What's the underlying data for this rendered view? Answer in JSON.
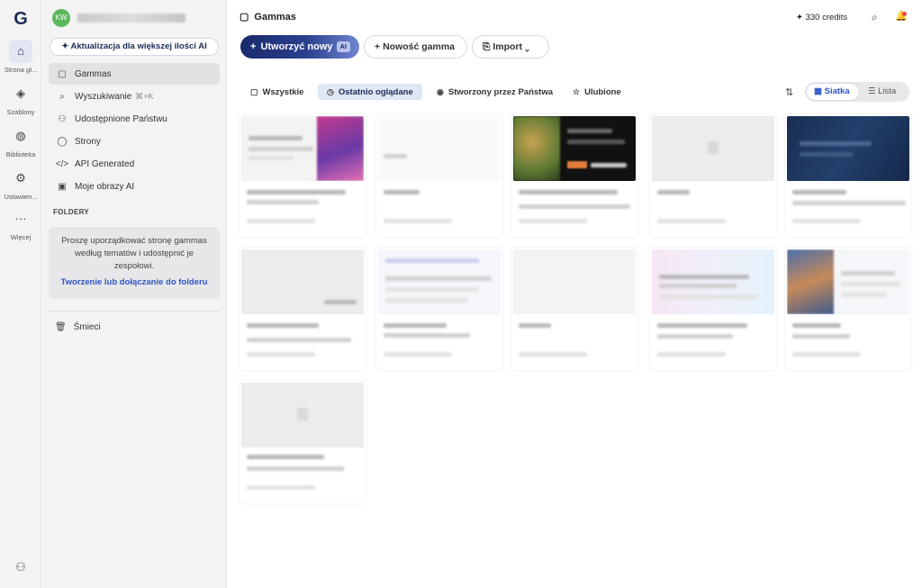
{
  "rail": {
    "logo": "G",
    "items": [
      {
        "label": "Strona gł...",
        "icon": "home-icon",
        "glyph": "⌂",
        "active": true
      },
      {
        "label": "Szablony",
        "icon": "layers-icon",
        "glyph": "◈",
        "active": false
      },
      {
        "label": "Biblioteka",
        "icon": "palette-icon",
        "glyph": "◍",
        "active": false
      },
      {
        "label": "Ustawien...",
        "icon": "gear-icon",
        "glyph": "⚙",
        "active": false
      },
      {
        "label": "Więcej",
        "icon": "more-icon",
        "glyph": "···",
        "active": false
      }
    ],
    "bottom_icon": "add-user-icon",
    "bottom_glyph": "⚇"
  },
  "sidebar": {
    "avatar_initials": "KW",
    "upgrade_label": "Aktualizacja dla większej ilości AI",
    "nav": [
      {
        "label": "Gammas",
        "icon": "file-icon",
        "glyph": "▢",
        "active": true
      },
      {
        "label": "Wyszukiwanie",
        "shortcut": "⌘+K",
        "icon": "search-icon",
        "glyph": "⌕",
        "active": false
      },
      {
        "label": "Udostępnione Państwu",
        "icon": "users-icon",
        "glyph": "⚇",
        "active": false
      },
      {
        "label": "Strony",
        "icon": "globe-icon",
        "glyph": "◯",
        "active": false
      },
      {
        "label": "API Generated",
        "icon": "code-icon",
        "glyph": "</>",
        "active": false
      },
      {
        "label": "Moje obrazy AI",
        "icon": "image-icon",
        "glyph": "▣",
        "active": false
      }
    ],
    "folders_title": "FOLDERY",
    "folder_text": "Proszę uporządkować stronę gammas według tematów i udostępnić je zespołowi.",
    "folder_link": "Tworzenie lub dołączanie do folderu",
    "trash_label": "Śmieci"
  },
  "header": {
    "title": "Gammas",
    "credits": "330 credits"
  },
  "actions": {
    "create_label": "Utworzyć nowy",
    "ai_badge": "AI",
    "new_label": "Nowość gamma",
    "import_label": "Import"
  },
  "filters": [
    {
      "label": "Wszystkie",
      "icon": "file-icon",
      "glyph": "▢",
      "active": false
    },
    {
      "label": "Ostatnio oglądane",
      "icon": "clock-icon",
      "glyph": "◷",
      "active": true
    },
    {
      "label": "Stworzony przez Państwa",
      "icon": "user-circle-icon",
      "glyph": "◉",
      "active": false
    },
    {
      "label": "Ulubione",
      "icon": "star-icon",
      "glyph": "☆",
      "active": false
    }
  ],
  "view": {
    "grid_label": "Siatka",
    "list_label": "Lista",
    "selected": "grid"
  }
}
